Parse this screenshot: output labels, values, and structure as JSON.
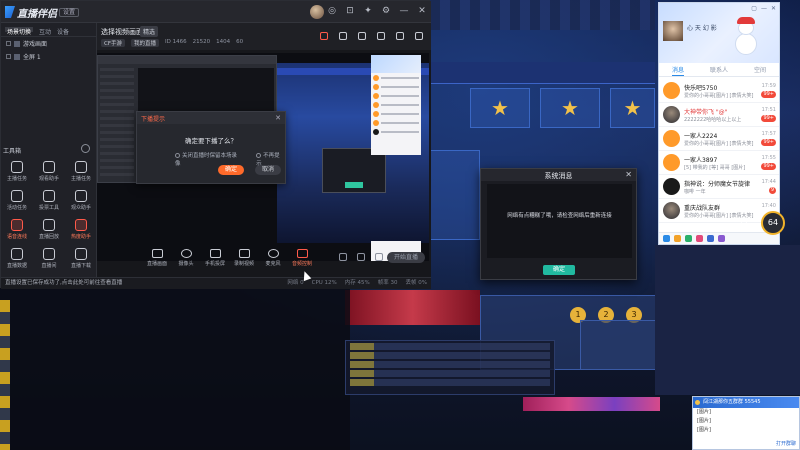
{
  "app": {
    "logo_text": "直播伴侣",
    "badge": "设置",
    "window_controls": [
      "◎",
      "⊡",
      "✦",
      "⚙",
      "—",
      "✕"
    ],
    "scene_tabs": [
      "场景切换",
      "互动",
      "设备"
    ],
    "scenes": [
      {
        "label": "游戏画面"
      },
      {
        "label": "全屏 1"
      }
    ],
    "toolbox_title": "工具箱",
    "tools": [
      {
        "label": "主播任务",
        "hot": false
      },
      {
        "label": "观看助手",
        "hot": false
      },
      {
        "label": "主播任务",
        "hot": false
      },
      {
        "label": "活动任务",
        "hot": false
      },
      {
        "label": "投票工具",
        "hot": false
      },
      {
        "label": "观众助手",
        "hot": false
      },
      {
        "label": "语音连线",
        "hot": true
      },
      {
        "label": "直播回放",
        "hot": false
      },
      {
        "label": "热度助手",
        "hot": true
      },
      {
        "label": "直播数据",
        "hot": false
      },
      {
        "label": "直播间",
        "hot": false
      },
      {
        "label": "直播下载",
        "hot": false
      }
    ],
    "status_text": "直播设置已保存成功了,点击此处可前往查看直播",
    "status_stats": [
      "网络 0",
      "CPU 12%",
      "内存 45%",
      "帧率 30",
      "丢帧 0%"
    ]
  },
  "room": {
    "title": "选择视频画面",
    "tag": "精选",
    "sub": [
      {
        "text": "CF手游",
        "pill": true
      },
      {
        "text": "我的直播",
        "pill": true
      },
      {
        "text": "ID 1466",
        "pill": false
      },
      {
        "text": "21520",
        "pill": false
      },
      {
        "text": "1404",
        "pill": false
      },
      {
        "text": "60",
        "pill": false
      }
    ]
  },
  "stop_dialog": {
    "title": "下播提示",
    "close": "✕",
    "message": "确定要下播了么？",
    "options": [
      "关闭直播时保留本场录像",
      "不再提示"
    ],
    "ok": "确定",
    "cancel": "取消"
  },
  "bottom_tools": [
    {
      "label": "直播画面",
      "icon": "monitor-icon",
      "red": false
    },
    {
      "label": "摄像头",
      "icon": "camera-icon",
      "red": false
    },
    {
      "label": "手机投屏",
      "icon": "phone-cast-icon",
      "red": false
    },
    {
      "label": "录制视频",
      "icon": "record-icon",
      "red": false
    },
    {
      "label": "麦克风",
      "icon": "microphone-icon",
      "red": false
    },
    {
      "label": "音频控制",
      "icon": "speaker-icon",
      "red": true
    }
  ],
  "live_button": "开始直播",
  "system_message": {
    "title": "系统消息",
    "close": "✕",
    "text": "网络有点糟糕了哦，请检查网络后重新连接",
    "ok": "确定"
  },
  "qq": {
    "name": "心 天 幻 影",
    "controls": [
      "▢",
      "—",
      "✕"
    ],
    "tabs": [
      "消息",
      "联系人",
      "空间"
    ],
    "items": [
      {
        "name": "快乐吧5750",
        "snippet": "爱你的小哥哥[图片] [表情大笑]",
        "time": "17:59",
        "count": "99+",
        "red": false,
        "avatar": "orange"
      },
      {
        "name": "大神带你飞 \"@\" ",
        "snippet": "2222222哈哈哈以上以上",
        "time": "17:51",
        "count": "99+",
        "red": true,
        "avatar": "img"
      },
      {
        "name": "一家人2224",
        "snippet": "爱你的小哥哥[图片] [表情大笑]",
        "time": "17:57",
        "count": "99+",
        "red": false,
        "avatar": "orange"
      },
      {
        "name": "一家人3897",
        "snippet": "[5] 带我的 [等] 哥哥 [图片]",
        "time": "17:55",
        "count": "99+",
        "red": false,
        "avatar": "orange"
      },
      {
        "name": "指神说：分师魔女节旋律",
        "snippet": "咖啡 一年",
        "time": "17:44",
        "count": "9",
        "red": false,
        "avatar": "dark"
      },
      {
        "name": "重庆战队友群",
        "snippet": "爱你的小哥哥[图片] [表情大笑]",
        "time": "17:40",
        "count": "",
        "red": false,
        "avatar": "img"
      }
    ],
    "foot_colors": [
      "#2a8ae6",
      "#f2a22a",
      "#2ab06a",
      "#e24a7a",
      "#3a6ad0",
      "#8a5ad0"
    ]
  },
  "speed_badge": "64",
  "notification": {
    "title": "闯江湖那你五群群 55545",
    "lines": [
      "[图片]",
      "[图片]",
      "[图片]"
    ],
    "footer": "打开群聊"
  },
  "colors": {
    "accent": "#ff6a2a",
    "teal": "#21b9a0",
    "qq_blue": "#2a8ae6"
  }
}
